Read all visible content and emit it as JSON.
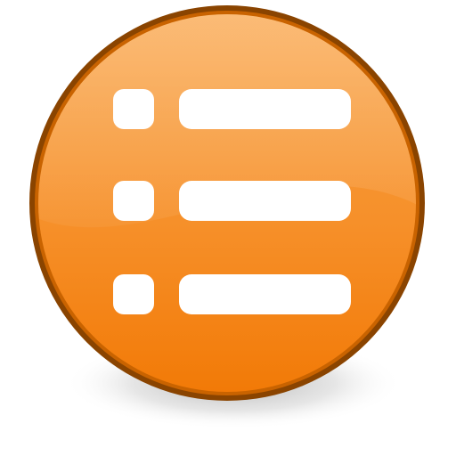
{
  "icon": {
    "name": "bulleted-list-icon",
    "colors": {
      "rim": "#8a4400",
      "face_top": "#f9a040",
      "face_bottom": "#f27a07",
      "highlight": "#ffffff",
      "glyph": "#ffffff",
      "shadow": "#7d7d7d"
    },
    "rows": 3
  }
}
